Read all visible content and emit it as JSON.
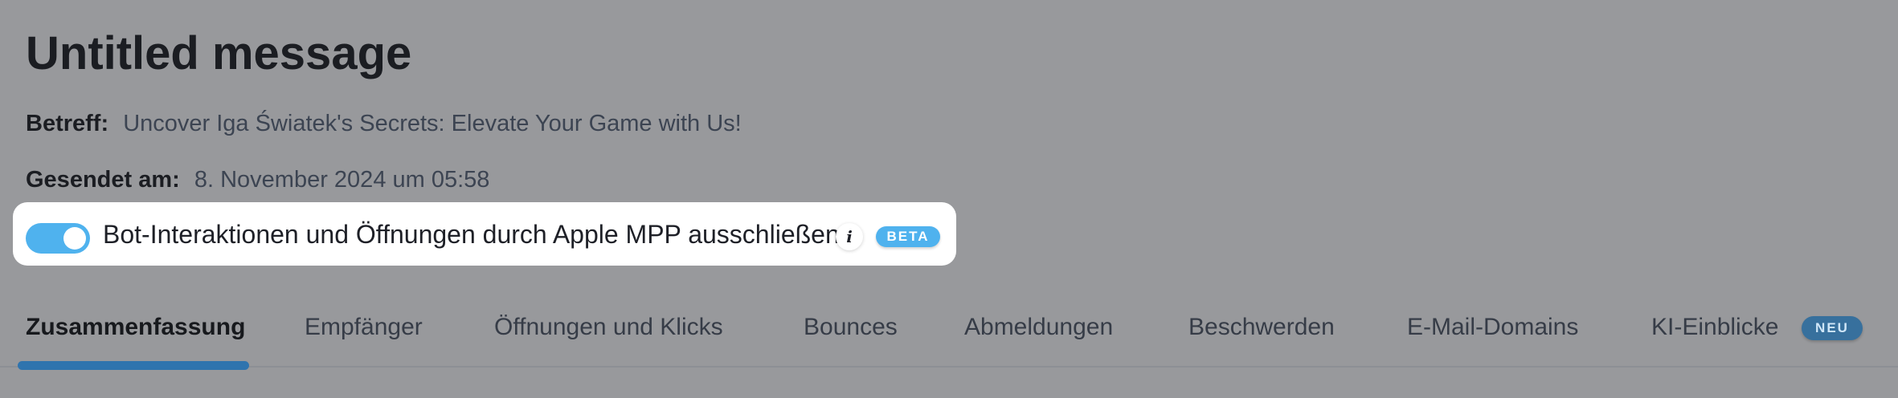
{
  "header": {
    "title": "Untitled message",
    "subject_label": "Betreff:",
    "subject_value": "Uncover Iga Światek's Secrets: Elevate Your Game with Us!",
    "sent_label": "Gesendet am:",
    "sent_value": "8. November 2024 um 05:58"
  },
  "filter_toggle": {
    "label": "Bot-Interaktionen und Öffnungen durch Apple MPP ausschließen",
    "enabled": true,
    "info_icon_glyph": "i",
    "info_icon": "info-icon",
    "badge": "BETA"
  },
  "tabs": [
    {
      "label": "Zusammenfassung",
      "active": true
    },
    {
      "label": "Empfänger",
      "active": false
    },
    {
      "label": "Öffnungen und Klicks",
      "active": false
    },
    {
      "label": "Bounces",
      "active": false
    },
    {
      "label": "Abmeldungen",
      "active": false
    },
    {
      "label": "Beschwerden",
      "active": false
    },
    {
      "label": "E-Mail-Domains",
      "active": false
    },
    {
      "label": "KI-Einblicke",
      "active": false,
      "badge": "NEU"
    }
  ],
  "colors": {
    "background": "#98999c",
    "accent": "#4fb2ee",
    "active_tab_indicator": "#2f74ae",
    "neu_badge": "#37709d"
  }
}
